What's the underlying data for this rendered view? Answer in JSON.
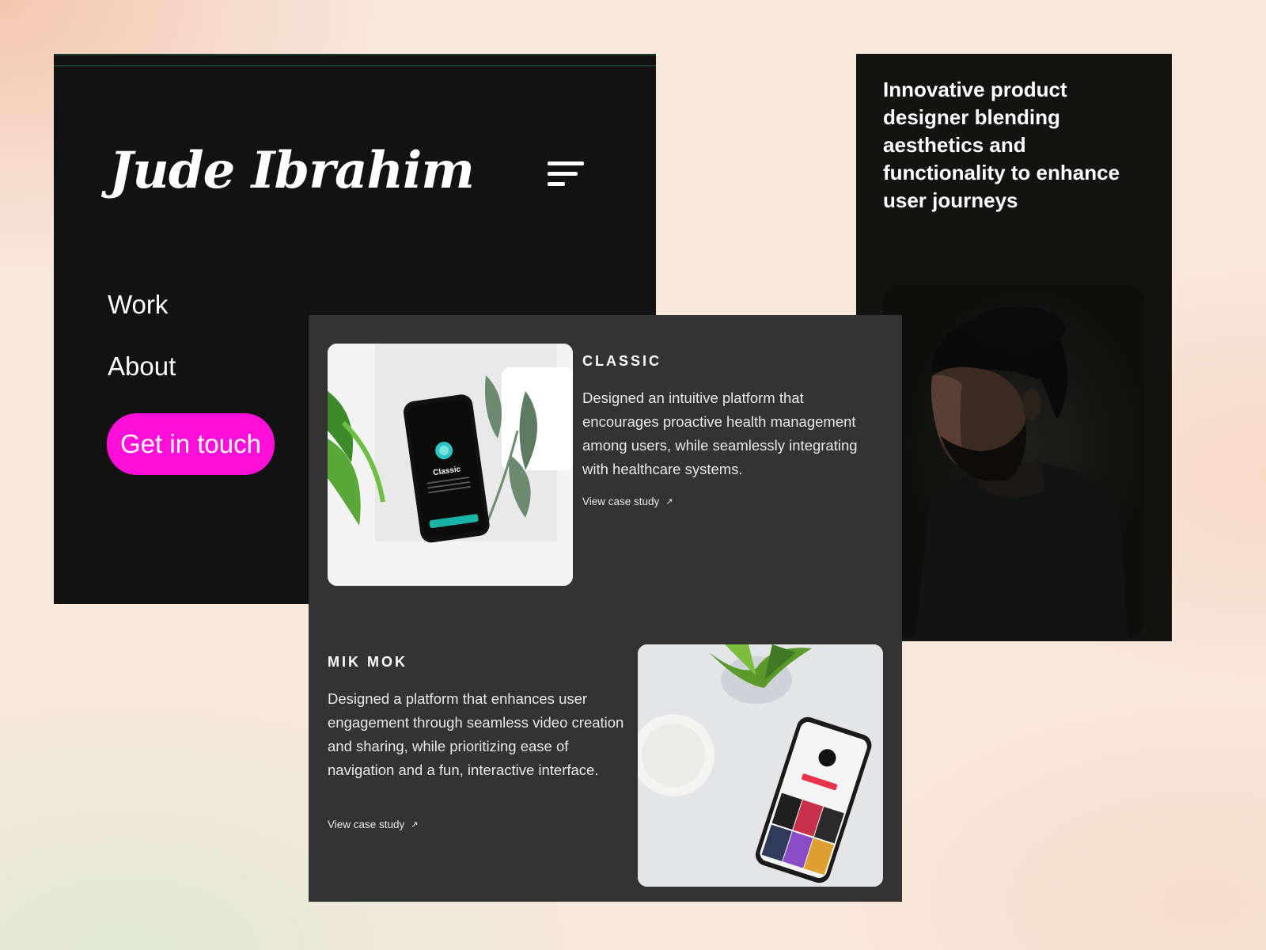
{
  "nav": {
    "logo": "Jude Ibrahim",
    "menu_icon": "hamburger-menu-icon",
    "links": [
      "Work",
      "About"
    ],
    "cta_label": "Get in touch",
    "cta_color": "#ff0fd8"
  },
  "bio": {
    "headline": "Innovative product designer blending aesthetics and functionality to enhance user journeys"
  },
  "projects": [
    {
      "title": "CLASSIC",
      "description": "Designed an intuitive platform that encourages proactive health management among users, while seamlessly integrating with healthcare systems.",
      "link_label": "View case study",
      "phone_app_name": "Classic"
    },
    {
      "title": "MIK MOK",
      "description": "Designed a platform that enhances user engagement through seamless video creation and sharing, while prioritizing ease of navigation and a fun, interactive interface.",
      "link_label": "View case study"
    }
  ],
  "colors": {
    "nav_bg": "#121212",
    "work_bg": "#333333",
    "bio_bg": "#131411"
  }
}
